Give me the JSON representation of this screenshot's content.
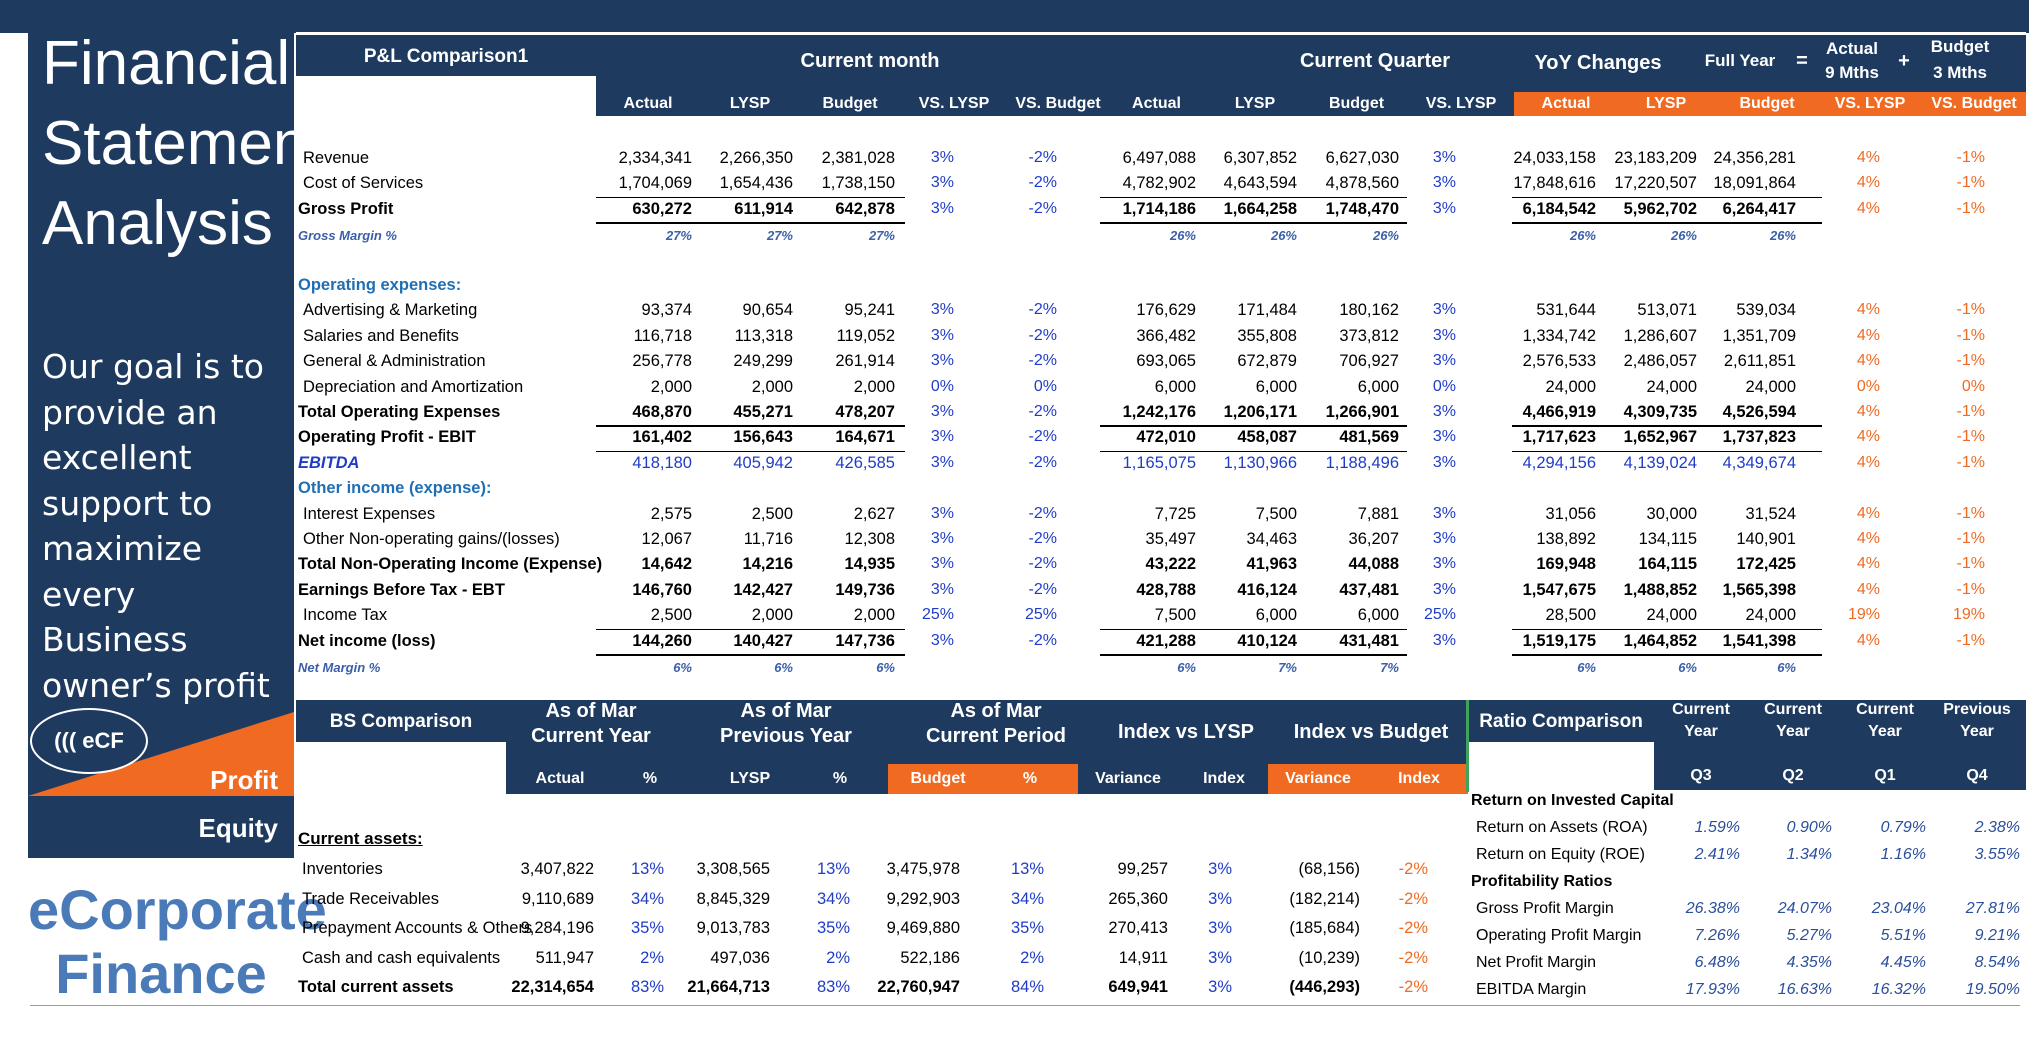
{
  "sidebar": {
    "title_lines": [
      "Financial",
      "Statement",
      "Analysis"
    ],
    "goal_lines": [
      "Our goal is to",
      "provide an",
      "excellent",
      "support to",
      "maximize every",
      "Business",
      "owner’s profit"
    ],
    "logo": "((( eCF",
    "profit_label": "Profit",
    "equity_label": "Equity",
    "brand_lines": [
      "eCorporate",
      "Finance"
    ]
  },
  "pl": {
    "title": "P&L Comparison1",
    "groups": {
      "current_month": "Current month",
      "current_quarter": "Current Quarter",
      "yoy": "YoY Changes",
      "full_year": "Full Year",
      "equals": "=",
      "actual9": [
        "Actual",
        "9 Mths"
      ],
      "plus": "+",
      "budget3": [
        "Budget",
        "3 Mths"
      ]
    },
    "columns": [
      "Actual",
      "LYSP",
      "Budget",
      "VS. LYSP",
      "VS. Budget",
      "Actual",
      "LYSP",
      "Budget",
      "VS. LYSP",
      "Actual",
      "LYSP",
      "Budget",
      "VS. LYSP",
      "VS. Budget"
    ],
    "rows": [
      {
        "label": "Revenue",
        "style": "item",
        "values": [
          "2,334,341",
          "2,266,350",
          "2,381,028",
          "3%",
          "-2%",
          "6,497,088",
          "6,307,852",
          "6,627,030",
          "3%",
          "24,033,158",
          "23,183,209",
          "24,356,281",
          "4%",
          "-1%"
        ]
      },
      {
        "label": "Cost of Services",
        "style": "item",
        "values": [
          "1,704,069",
          "1,654,436",
          "1,738,150",
          "3%",
          "-2%",
          "4,782,902",
          "4,643,594",
          "4,878,560",
          "3%",
          "17,848,616",
          "17,220,507",
          "18,091,864",
          "4%",
          "-1%"
        ]
      },
      {
        "label": "Gross Profit",
        "style": "bold",
        "values": [
          "630,272",
          "611,914",
          "642,878",
          "3%",
          "-2%",
          "1,714,186",
          "1,664,258",
          "1,748,470",
          "3%",
          "6,184,542",
          "5,962,702",
          "6,264,417",
          "4%",
          "-1%"
        ]
      },
      {
        "label": "Gross Margin %",
        "style": "margin",
        "values": [
          "27%",
          "27%",
          "27%",
          "",
          "",
          "26%",
          "26%",
          "26%",
          "",
          "26%",
          "26%",
          "26%",
          "",
          ""
        ]
      },
      {
        "label": "",
        "style": "blank",
        "values": []
      },
      {
        "label": "Operating expenses:",
        "style": "section",
        "values": []
      },
      {
        "label": "Advertising & Marketing",
        "style": "item",
        "values": [
          "93,374",
          "90,654",
          "95,241",
          "3%",
          "-2%",
          "176,629",
          "171,484",
          "180,162",
          "3%",
          "531,644",
          "513,071",
          "539,034",
          "4%",
          "-1%"
        ]
      },
      {
        "label": "Salaries and Benefits",
        "style": "item",
        "values": [
          "116,718",
          "113,318",
          "119,052",
          "3%",
          "-2%",
          "366,482",
          "355,808",
          "373,812",
          "3%",
          "1,334,742",
          "1,286,607",
          "1,351,709",
          "4%",
          "-1%"
        ]
      },
      {
        "label": "General & Administration",
        "style": "item",
        "values": [
          "256,778",
          "249,299",
          "261,914",
          "3%",
          "-2%",
          "693,065",
          "672,879",
          "706,927",
          "3%",
          "2,576,533",
          "2,486,057",
          "2,611,851",
          "4%",
          "-1%"
        ]
      },
      {
        "label": "Depreciation and Amortization",
        "style": "item",
        "values": [
          "2,000",
          "2,000",
          "2,000",
          "0%",
          "0%",
          "6,000",
          "6,000",
          "6,000",
          "0%",
          "24,000",
          "24,000",
          "24,000",
          "0%",
          "0%"
        ]
      },
      {
        "label": "Total Operating Expenses",
        "style": "bold",
        "values": [
          "468,870",
          "455,271",
          "478,207",
          "3%",
          "-2%",
          "1,242,176",
          "1,206,171",
          "1,266,901",
          "3%",
          "4,466,919",
          "4,309,735",
          "4,526,594",
          "4%",
          "-1%"
        ]
      },
      {
        "label": "Operating Profit - EBIT",
        "style": "bold",
        "values": [
          "161,402",
          "156,643",
          "164,671",
          "3%",
          "-2%",
          "472,010",
          "458,087",
          "481,569",
          "3%",
          "1,717,623",
          "1,652,967",
          "1,737,823",
          "4%",
          "-1%"
        ]
      },
      {
        "label": "EBITDA",
        "style": "ebitda",
        "values": [
          "418,180",
          "405,942",
          "426,585",
          "3%",
          "-2%",
          "1,165,075",
          "1,130,966",
          "1,188,496",
          "3%",
          "4,294,156",
          "4,139,024",
          "4,349,674",
          "4%",
          "-1%"
        ]
      },
      {
        "label": "Other income (expense):",
        "style": "section",
        "values": []
      },
      {
        "label": "Interest Expenses",
        "style": "item",
        "values": [
          "2,575",
          "2,500",
          "2,627",
          "3%",
          "-2%",
          "7,725",
          "7,500",
          "7,881",
          "3%",
          "31,056",
          "30,000",
          "31,524",
          "4%",
          "-1%"
        ]
      },
      {
        "label": "Other Non-operating gains/(losses)",
        "style": "item",
        "values": [
          "12,067",
          "11,716",
          "12,308",
          "3%",
          "-2%",
          "35,497",
          "34,463",
          "36,207",
          "3%",
          "138,892",
          "134,115",
          "140,901",
          "4%",
          "-1%"
        ]
      },
      {
        "label": "Total Non-Operating Income (Expense)",
        "style": "bold",
        "values": [
          "14,642",
          "14,216",
          "14,935",
          "3%",
          "-2%",
          "43,222",
          "41,963",
          "44,088",
          "3%",
          "169,948",
          "164,115",
          "172,425",
          "4%",
          "-1%"
        ]
      },
      {
        "label": "Earnings Before Tax - EBT",
        "style": "bold",
        "values": [
          "146,760",
          "142,427",
          "149,736",
          "3%",
          "-2%",
          "428,788",
          "416,124",
          "437,481",
          "3%",
          "1,547,675",
          "1,488,852",
          "1,565,398",
          "4%",
          "-1%"
        ]
      },
      {
        "label": "Income Tax",
        "style": "item",
        "values": [
          "2,500",
          "2,000",
          "2,000",
          "25%",
          "25%",
          "7,500",
          "6,000",
          "6,000",
          "25%",
          "28,500",
          "24,000",
          "24,000",
          "19%",
          "19%"
        ]
      },
      {
        "label": "Net income (loss)",
        "style": "bold",
        "values": [
          "144,260",
          "140,427",
          "147,736",
          "3%",
          "-2%",
          "421,288",
          "410,124",
          "431,481",
          "3%",
          "1,519,175",
          "1,464,852",
          "1,541,398",
          "4%",
          "-1%"
        ]
      },
      {
        "label": "Net Margin %",
        "style": "margin",
        "values": [
          "6%",
          "6%",
          "6%",
          "",
          "",
          "6%",
          "7%",
          "7%",
          "",
          "6%",
          "6%",
          "6%",
          "",
          ""
        ]
      }
    ]
  },
  "bs": {
    "title": "BS Comparison",
    "groups": [
      [
        "As of  Mar",
        "Current Year"
      ],
      [
        "As of  Mar",
        "Previous Year"
      ],
      [
        "As of  Mar",
        "Current Period"
      ],
      [
        "Index vs LYSP"
      ],
      [
        "Index vs Budget"
      ]
    ],
    "columns": [
      "Actual",
      "%",
      "LYSP",
      "%",
      "Budget",
      "%",
      "Variance",
      "Index",
      "Variance",
      "Index"
    ],
    "section": "Current assets:",
    "rows": [
      {
        "label": "Inventories",
        "bold": false,
        "values": [
          "3,407,822",
          "13%",
          "3,308,565",
          "13%",
          "3,475,978",
          "13%",
          "99,257",
          "3%",
          "(68,156)",
          "-2%"
        ]
      },
      {
        "label": "Trade Receivables",
        "bold": false,
        "values": [
          "9,110,689",
          "34%",
          "8,845,329",
          "34%",
          "9,292,903",
          "34%",
          "265,360",
          "3%",
          "(182,214)",
          "-2%"
        ]
      },
      {
        "label": "Prepayment Accounts & Others",
        "bold": false,
        "values": [
          "9,284,196",
          "35%",
          "9,013,783",
          "35%",
          "9,469,880",
          "35%",
          "270,413",
          "3%",
          "(185,684)",
          "-2%"
        ]
      },
      {
        "label": "Cash and cash equivalents",
        "bold": false,
        "values": [
          "511,947",
          "2%",
          "497,036",
          "2%",
          "522,186",
          "2%",
          "14,911",
          "3%",
          "(10,239)",
          "-2%"
        ]
      },
      {
        "label": "Total current assets",
        "bold": true,
        "values": [
          "22,314,654",
          "83%",
          "21,664,713",
          "83%",
          "22,760,947",
          "84%",
          "649,941",
          "3%",
          "(446,293)",
          "-2%"
        ]
      }
    ]
  },
  "ratio": {
    "title": "Ratio Comparison",
    "groups": [
      [
        "Current",
        "Year"
      ],
      [
        "Current",
        "Year"
      ],
      [
        "Current",
        "Year"
      ],
      [
        "Previous",
        "Year"
      ]
    ],
    "columns": [
      "Q3",
      "Q2",
      "Q1",
      "Q4"
    ],
    "rows": [
      {
        "label": "Return on Invested Capital",
        "style": "section",
        "values": []
      },
      {
        "label": "Return on Assets (ROA)",
        "style": "item",
        "values": [
          "1.59%",
          "0.90%",
          "0.79%",
          "2.38%"
        ]
      },
      {
        "label": "Return on Equity (ROE)",
        "style": "item",
        "values": [
          "2.41%",
          "1.34%",
          "1.16%",
          "3.55%"
        ]
      },
      {
        "label": "Profitability Ratios",
        "style": "section",
        "values": []
      },
      {
        "label": "Gross Profit Margin",
        "style": "item",
        "values": [
          "26.38%",
          "24.07%",
          "23.04%",
          "27.81%"
        ]
      },
      {
        "label": "Operating Profit Margin",
        "style": "item",
        "values": [
          "7.26%",
          "5.27%",
          "5.51%",
          "9.21%"
        ]
      },
      {
        "label": "Net Profit Margin",
        "style": "item",
        "values": [
          "6.48%",
          "4.35%",
          "4.45%",
          "8.54%"
        ]
      },
      {
        "label": "EBITDA Margin",
        "style": "item",
        "values": [
          "17.93%",
          "16.63%",
          "16.32%",
          "19.50%"
        ]
      }
    ]
  }
}
